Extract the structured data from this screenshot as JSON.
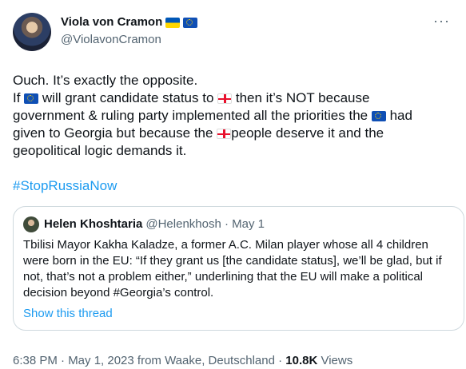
{
  "tweet": {
    "display_name": "Viola von Cramon",
    "handle": "@ViolavonCramon",
    "body_lines": [
      [
        "Ouch. It’s exactly the opposite."
      ],
      [
        "If ",
        " will grant candidate status to ",
        " then it’s NOT because"
      ],
      [
        "government & ruling party implemented all the priorities the ",
        " had"
      ],
      [
        "given to Georgia but because the ",
        "people deserve it and the"
      ],
      [
        "geopolitical logic demands it."
      ]
    ],
    "hashtag": "#StopRussiaNow",
    "timestamp": "6:38 PM · May 1, 2023 from Waake, Deutschland · ",
    "views_count": "10.8K",
    "views_label": " Views"
  },
  "quote": {
    "name": "Helen Khoshtaria",
    "meta": "@Helenkhosh · May 1",
    "lines": [
      "Tbilisi Mayor Kakha Kaladze, a former A.C. Milan player whose all 4 children",
      "were born in the EU: “If they grant us [the candidate status], we’ll be glad, but if",
      "not, that’s not a problem either,” underlining that the EU will make a political",
      "decision beyond #Georgia’s control."
    ],
    "show_thread": "Show this thread"
  },
  "icons": {
    "more": "more-icon",
    "flags": [
      "ukraine-flag-icon",
      "eu-flag-icon",
      "georgia-flag-icon"
    ]
  },
  "colors": {
    "link": "#1d9bf0",
    "secondary": "#536471",
    "text": "#0f1419",
    "border": "#cfd9de"
  }
}
